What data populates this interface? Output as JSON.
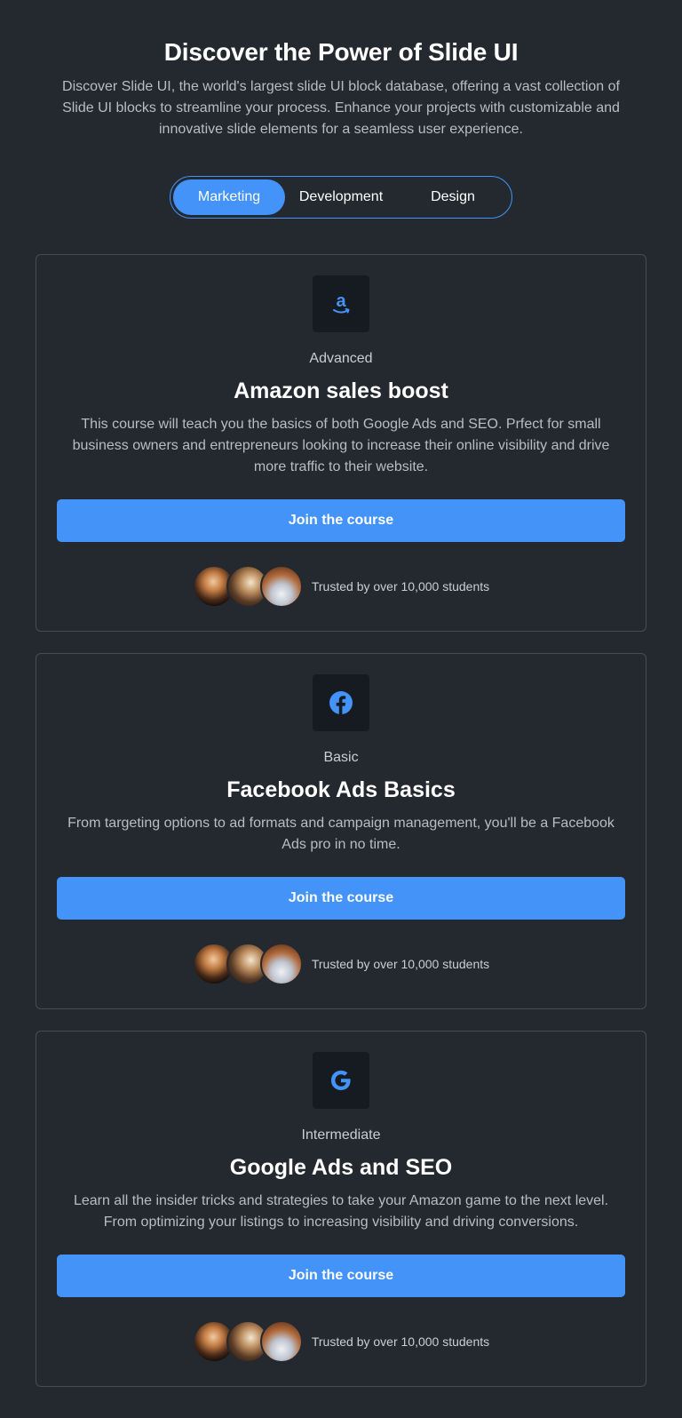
{
  "header": {
    "title": "Discover the Power of Slide UI",
    "subtitle": "Discover Slide UI, the world's largest slide UI block database, offering a vast collection of Slide UI blocks to streamline your process. Enhance your projects with customizable and innovative slide elements for a seamless user experience."
  },
  "tabs": [
    {
      "label": "Marketing",
      "active": true
    },
    {
      "label": "Development",
      "active": false
    },
    {
      "label": "Design",
      "active": false
    }
  ],
  "colors": {
    "background": "#24292f",
    "accent": "#4493f8",
    "card_border": "#454c56",
    "logo_box": "#161b22"
  },
  "cards": [
    {
      "icon": "amazon-icon",
      "level": "Advanced",
      "title": "Amazon sales boost",
      "description": "This course will teach you the basics of both Google Ads and SEO. Prfect for small business owners and entrepreneurs looking to increase their online visibility and drive more traffic to their website.",
      "button_label": "Join the course",
      "trust_text": "Trusted by over 10,000 students"
    },
    {
      "icon": "facebook-icon",
      "level": "Basic",
      "title": "Facebook Ads Basics",
      "description": "From targeting options to ad formats and campaign management, you'll be a Facebook Ads pro in no time.",
      "button_label": "Join the course",
      "trust_text": "Trusted by over 10,000 students"
    },
    {
      "icon": "google-icon",
      "level": "Intermediate",
      "title": "Google Ads and SEO",
      "description": "Learn all the insider tricks and strategies to take your Amazon game to the next level. From optimizing your listings to increasing visibility and driving conversions.",
      "button_label": "Join the course",
      "trust_text": "Trusted by over 10,000 students"
    }
  ]
}
